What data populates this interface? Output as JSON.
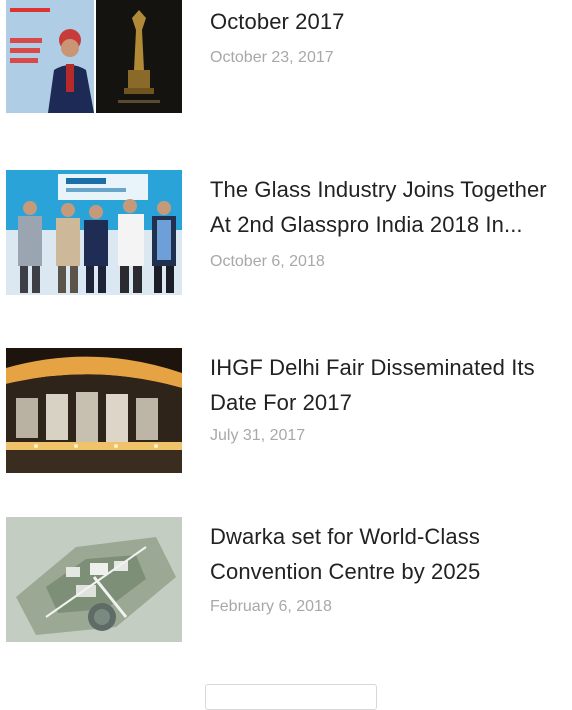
{
  "posts": [
    {
      "title": "October 2017",
      "date": "October 23, 2017"
    },
    {
      "title": "The Glass Industry Joins Together At 2nd Glasspro India 2018 In...",
      "date": "October 6, 2018"
    },
    {
      "title": "IHGF Delhi Fair Disseminated Its Date For 2017",
      "date": "July 31, 2017"
    },
    {
      "title": "Dwarka set for World-Class Convention Centre by 2025",
      "date": "February 6, 2018"
    }
  ],
  "colors": {
    "title": "#222222",
    "date": "#a8a8a8",
    "background": "#ffffff"
  },
  "load_more": {
    "label": ""
  }
}
